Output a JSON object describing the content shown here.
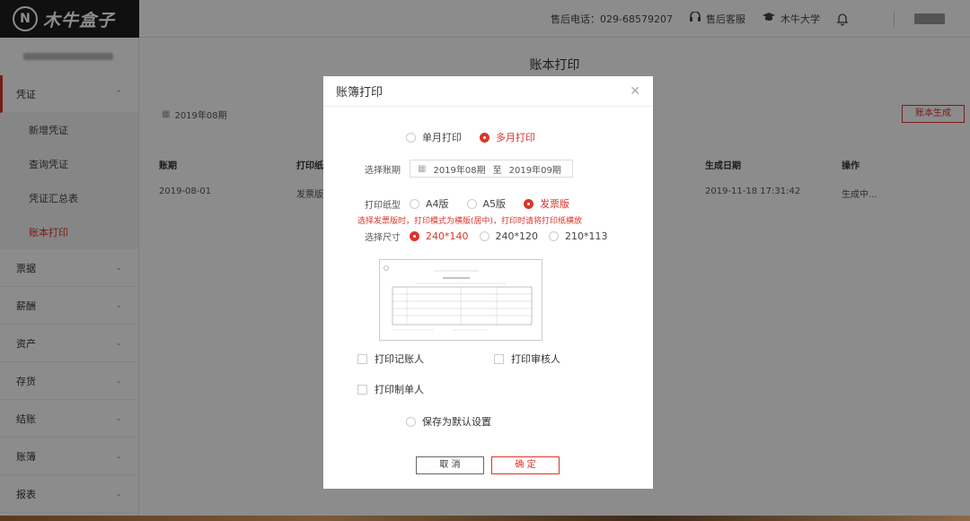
{
  "app": {
    "brand": "木牛盒子",
    "logo_mark": "N"
  },
  "topbar": {
    "hotline": "售后电话：029-68579207",
    "support": "售后客服",
    "university": "木牛大学"
  },
  "sidebar": {
    "menu": [
      {
        "label": "凭证",
        "expanded": true
      },
      {
        "label": "票据"
      },
      {
        "label": "薪酬"
      },
      {
        "label": "资产"
      },
      {
        "label": "存货"
      },
      {
        "label": "结账"
      },
      {
        "label": "账簿"
      },
      {
        "label": "报表"
      }
    ],
    "voucher_sub": [
      "新增凭证",
      "查询凭证",
      "凭证汇总表",
      "账本打印"
    ]
  },
  "main": {
    "title": "账本打印",
    "period_filter": "2019年08期",
    "generate_button": "账本生成",
    "columns": [
      "账期",
      "打印纸型",
      "生成日期",
      "操作"
    ],
    "rows": [
      {
        "period": "2019-08-01",
        "paper": "发票版",
        "date": "2019-11-18 17:31:42",
        "status": "生成中..."
      }
    ]
  },
  "modal": {
    "title": "账簿打印",
    "print_mode": {
      "single": "单月打印",
      "multi": "多月打印",
      "selected": "multi"
    },
    "period_label": "选择账期",
    "period_start": "2019年08期",
    "period_sep": "至",
    "period_end": "2019年09期",
    "paper_label": "打印纸型",
    "paper_options": [
      "A4版",
      "A5版",
      "发票版"
    ],
    "paper_selected": "发票版",
    "warning": "选择发票版时，打印模式为横版(居中)，打印时请将打印纸横放",
    "size_label": "选择尺寸",
    "size_options": [
      "240*140",
      "240*120",
      "210*113"
    ],
    "size_selected": "240*140",
    "checkboxes": [
      "打印记账人",
      "打印审核人",
      "打印制单人"
    ],
    "save_default": "保存为默认设置",
    "cancel": "取 消",
    "confirm": "确 定",
    "accent": "#d9362b"
  }
}
